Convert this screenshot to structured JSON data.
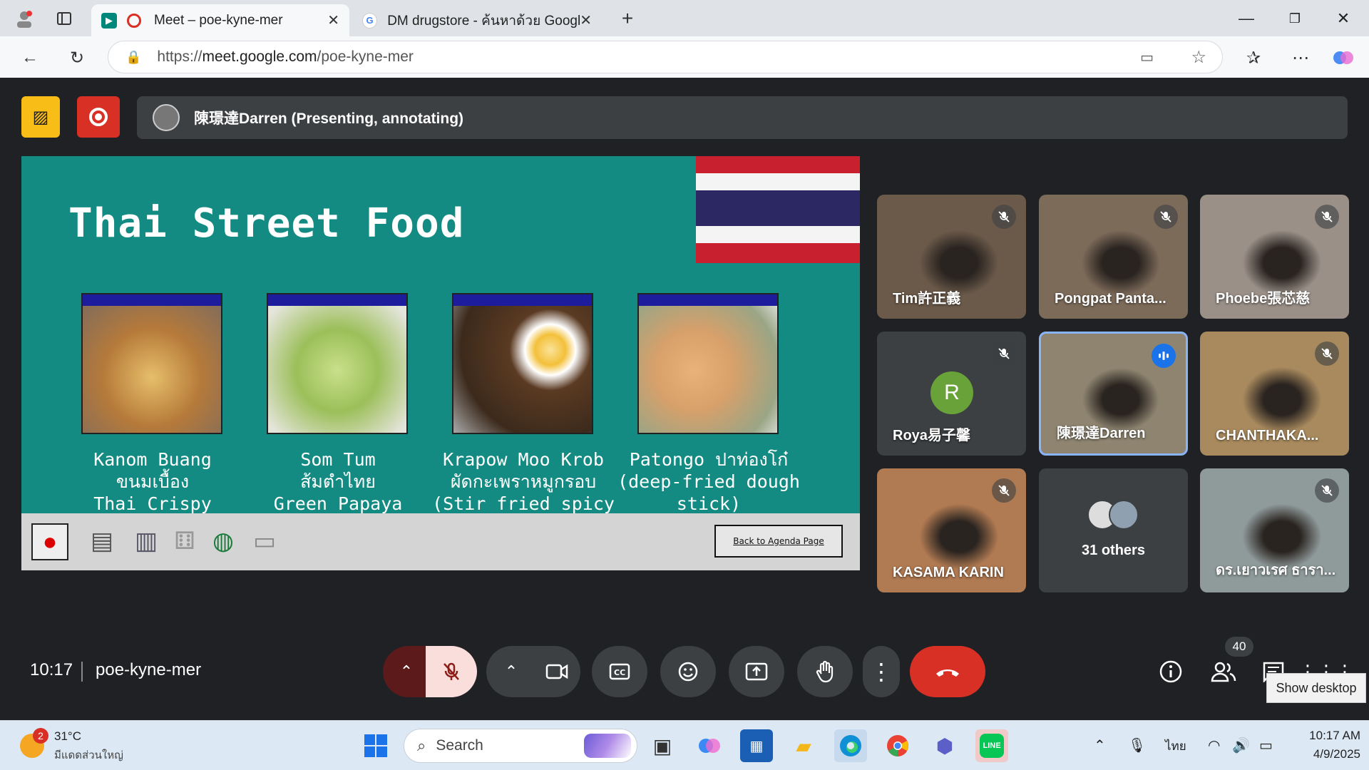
{
  "browser": {
    "tabs": [
      {
        "title": "Meet – poe-kyne-mer",
        "active": true
      },
      {
        "title": "DM drugstore - ค้นหาด้วย Google",
        "active": false
      }
    ],
    "url_prefix": "https://",
    "url_host": "meet.google.com",
    "url_path": "/poe-kyne-mer"
  },
  "meet": {
    "presenter_text": "陳璟達Darren (Presenting, annotating)",
    "time": "10:17",
    "meeting_code": "poe-kyne-mer",
    "participant_count": "40",
    "tooltip": "Show desktop"
  },
  "slide": {
    "title": "Thai Street Food",
    "foods": [
      {
        "caption": "Kanom Buang\nขนมเบื้อง\nThai Crispy\nPancakes",
        "color": "#c99a52"
      },
      {
        "caption": "Som Tum\nส้มตำไทย\nGreen Papaya\nSalad",
        "color": "#9cbf5a"
      },
      {
        "caption": "Krapow Moo Krob\nผัดกะเพราหมูกรอบ\n(Stir fried spicy\nwith crispy pork\nand Basil)",
        "color": "#5a3a22"
      },
      {
        "caption": "Patongo ปาท่องโก๋\n(deep-fried dough\nstick)",
        "color": "#d8a06a"
      }
    ],
    "back_button": "Back to Agenda Page"
  },
  "participants": [
    {
      "name": "Tim許正義",
      "muted": true,
      "bg": "#6b5a4a"
    },
    {
      "name": "Pongpat Panta...",
      "muted": true,
      "bg": "#7d6b5a"
    },
    {
      "name": "Phoebe張芯慈",
      "muted": true,
      "bg": "#9a9088"
    },
    {
      "name": "Roya易子馨",
      "muted": true,
      "bg": "#3c4043",
      "initial": "R"
    },
    {
      "name": "陳璟達Darren",
      "muted": false,
      "bg": "#8e8470",
      "speaking": true
    },
    {
      "name": "CHANTHAKA...",
      "muted": true,
      "bg": "#a98a5e"
    },
    {
      "name": "KASAMA KARIN",
      "muted": true,
      "bg": "#b07a52"
    },
    {
      "name": "31 others",
      "muted": false,
      "bg": "#3c4043",
      "others": true
    },
    {
      "name": "ดร.เยาวเรศ ธารา...",
      "muted": true,
      "bg": "#8f9a9a"
    }
  ],
  "taskbar": {
    "weather_temp": "31°C",
    "weather_desc": "มีแดดส่วนใหญ่",
    "weather_badge": "2",
    "search_placeholder": "Search",
    "lang": "ไทย",
    "clock_time": "10:17 AM",
    "clock_date": "4/9/2025"
  }
}
